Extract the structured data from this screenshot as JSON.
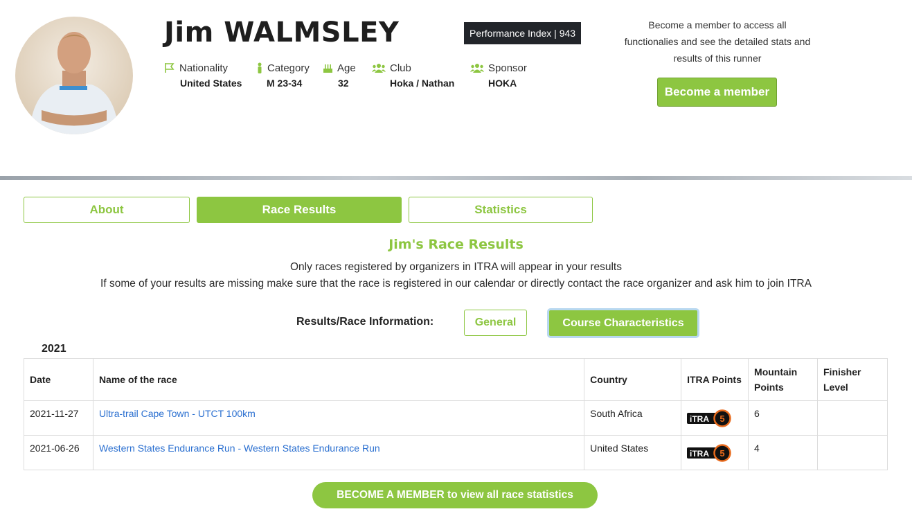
{
  "runner": {
    "name": "Jim WALMSLEY",
    "performance_index": "Performance Index | 943"
  },
  "info": {
    "nationality": {
      "label": "Nationality",
      "value": "United States",
      "icon": "flag-icon"
    },
    "category": {
      "label": "Category",
      "value": "M 23-34",
      "icon": "person-icon"
    },
    "age": {
      "label": "Age",
      "value": "32",
      "icon": "cake-icon"
    },
    "club": {
      "label": "Club",
      "value": "Hoka / Nathan",
      "icon": "group-icon"
    },
    "sponsor": {
      "label": "Sponsor",
      "value": "HOKA",
      "icon": "group-icon"
    }
  },
  "membership": {
    "line1": "Become a member to access all",
    "line2": "functionalies and see the detailed stats and",
    "line3": "results of this runner",
    "button": "Become a member"
  },
  "tabs": [
    {
      "label": "About",
      "active": false
    },
    {
      "label": "Race Results",
      "active": true
    },
    {
      "label": "Statistics",
      "active": false
    }
  ],
  "results_section": {
    "title": "Jim's Race Results",
    "notice1": "Only races registered by organizers in ITRA will appear in your results",
    "notice2": "If some of your results are missing make sure that the race is registered in our calendar or directly contact the race organizer and ask him to join ITRA",
    "filter_label": "Results/Race Information:",
    "general_button": "General",
    "course_button": "Course Characteristics",
    "year": "2021"
  },
  "table": {
    "headers": {
      "date": "Date",
      "name": "Name of the race",
      "country": "Country",
      "itra": "ITRA Points",
      "mountain1": "Mountain",
      "mountain2": "Points",
      "finisher1": "Finisher",
      "finisher2": "Level"
    },
    "rows": [
      {
        "date": "2021-11-27",
        "name": "Ultra-trail Cape Town - UTCT 100km",
        "country": "South Africa",
        "itra_points": "5",
        "mountain_points": "6",
        "finisher_level": ""
      },
      {
        "date": "2021-06-26",
        "name": "Western States Endurance Run - Western States Endurance Run",
        "country": "United States",
        "itra_points": "5",
        "mountain_points": "4",
        "finisher_level": ""
      }
    ],
    "badge_text": "iTRA"
  },
  "cta": "BECOME A MEMBER to view all race statistics",
  "colors": {
    "accent_green": "#8dc641",
    "link_blue": "#2a6fd0",
    "badge_dark": "#22252a",
    "itra_orange": "#e86a1c"
  }
}
